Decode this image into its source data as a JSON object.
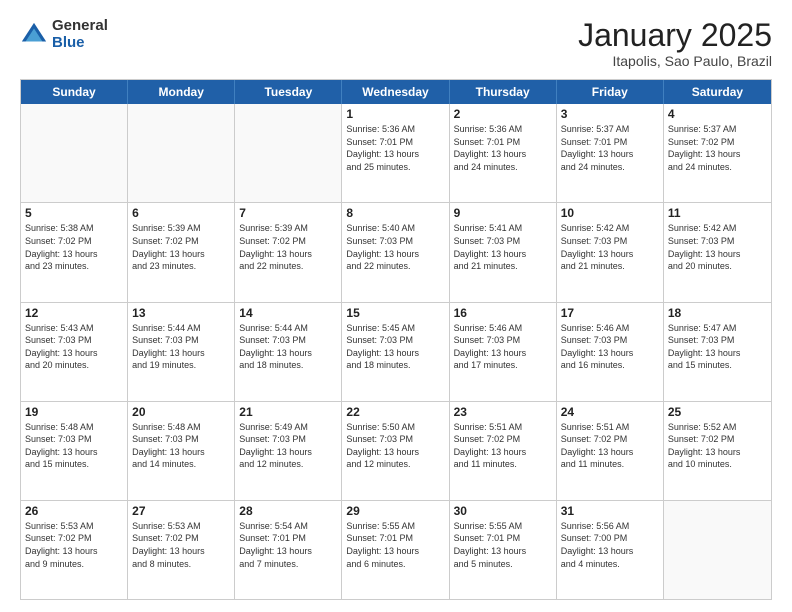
{
  "logo": {
    "general": "General",
    "blue": "Blue"
  },
  "header": {
    "month": "January 2025",
    "location": "Itapolis, Sao Paulo, Brazil"
  },
  "days_of_week": [
    "Sunday",
    "Monday",
    "Tuesday",
    "Wednesday",
    "Thursday",
    "Friday",
    "Saturday"
  ],
  "weeks": [
    [
      {
        "day": "",
        "info": ""
      },
      {
        "day": "",
        "info": ""
      },
      {
        "day": "",
        "info": ""
      },
      {
        "day": "1",
        "info": "Sunrise: 5:36 AM\nSunset: 7:01 PM\nDaylight: 13 hours\nand 25 minutes."
      },
      {
        "day": "2",
        "info": "Sunrise: 5:36 AM\nSunset: 7:01 PM\nDaylight: 13 hours\nand 24 minutes."
      },
      {
        "day": "3",
        "info": "Sunrise: 5:37 AM\nSunset: 7:01 PM\nDaylight: 13 hours\nand 24 minutes."
      },
      {
        "day": "4",
        "info": "Sunrise: 5:37 AM\nSunset: 7:02 PM\nDaylight: 13 hours\nand 24 minutes."
      }
    ],
    [
      {
        "day": "5",
        "info": "Sunrise: 5:38 AM\nSunset: 7:02 PM\nDaylight: 13 hours\nand 23 minutes."
      },
      {
        "day": "6",
        "info": "Sunrise: 5:39 AM\nSunset: 7:02 PM\nDaylight: 13 hours\nand 23 minutes."
      },
      {
        "day": "7",
        "info": "Sunrise: 5:39 AM\nSunset: 7:02 PM\nDaylight: 13 hours\nand 22 minutes."
      },
      {
        "day": "8",
        "info": "Sunrise: 5:40 AM\nSunset: 7:03 PM\nDaylight: 13 hours\nand 22 minutes."
      },
      {
        "day": "9",
        "info": "Sunrise: 5:41 AM\nSunset: 7:03 PM\nDaylight: 13 hours\nand 21 minutes."
      },
      {
        "day": "10",
        "info": "Sunrise: 5:42 AM\nSunset: 7:03 PM\nDaylight: 13 hours\nand 21 minutes."
      },
      {
        "day": "11",
        "info": "Sunrise: 5:42 AM\nSunset: 7:03 PM\nDaylight: 13 hours\nand 20 minutes."
      }
    ],
    [
      {
        "day": "12",
        "info": "Sunrise: 5:43 AM\nSunset: 7:03 PM\nDaylight: 13 hours\nand 20 minutes."
      },
      {
        "day": "13",
        "info": "Sunrise: 5:44 AM\nSunset: 7:03 PM\nDaylight: 13 hours\nand 19 minutes."
      },
      {
        "day": "14",
        "info": "Sunrise: 5:44 AM\nSunset: 7:03 PM\nDaylight: 13 hours\nand 18 minutes."
      },
      {
        "day": "15",
        "info": "Sunrise: 5:45 AM\nSunset: 7:03 PM\nDaylight: 13 hours\nand 18 minutes."
      },
      {
        "day": "16",
        "info": "Sunrise: 5:46 AM\nSunset: 7:03 PM\nDaylight: 13 hours\nand 17 minutes."
      },
      {
        "day": "17",
        "info": "Sunrise: 5:46 AM\nSunset: 7:03 PM\nDaylight: 13 hours\nand 16 minutes."
      },
      {
        "day": "18",
        "info": "Sunrise: 5:47 AM\nSunset: 7:03 PM\nDaylight: 13 hours\nand 15 minutes."
      }
    ],
    [
      {
        "day": "19",
        "info": "Sunrise: 5:48 AM\nSunset: 7:03 PM\nDaylight: 13 hours\nand 15 minutes."
      },
      {
        "day": "20",
        "info": "Sunrise: 5:48 AM\nSunset: 7:03 PM\nDaylight: 13 hours\nand 14 minutes."
      },
      {
        "day": "21",
        "info": "Sunrise: 5:49 AM\nSunset: 7:03 PM\nDaylight: 13 hours\nand 12 minutes."
      },
      {
        "day": "22",
        "info": "Sunrise: 5:50 AM\nSunset: 7:03 PM\nDaylight: 13 hours\nand 12 minutes."
      },
      {
        "day": "23",
        "info": "Sunrise: 5:51 AM\nSunset: 7:02 PM\nDaylight: 13 hours\nand 11 minutes."
      },
      {
        "day": "24",
        "info": "Sunrise: 5:51 AM\nSunset: 7:02 PM\nDaylight: 13 hours\nand 11 minutes."
      },
      {
        "day": "25",
        "info": "Sunrise: 5:52 AM\nSunset: 7:02 PM\nDaylight: 13 hours\nand 10 minutes."
      }
    ],
    [
      {
        "day": "26",
        "info": "Sunrise: 5:53 AM\nSunset: 7:02 PM\nDaylight: 13 hours\nand 9 minutes."
      },
      {
        "day": "27",
        "info": "Sunrise: 5:53 AM\nSunset: 7:02 PM\nDaylight: 13 hours\nand 8 minutes."
      },
      {
        "day": "28",
        "info": "Sunrise: 5:54 AM\nSunset: 7:01 PM\nDaylight: 13 hours\nand 7 minutes."
      },
      {
        "day": "29",
        "info": "Sunrise: 5:55 AM\nSunset: 7:01 PM\nDaylight: 13 hours\nand 6 minutes."
      },
      {
        "day": "30",
        "info": "Sunrise: 5:55 AM\nSunset: 7:01 PM\nDaylight: 13 hours\nand 5 minutes."
      },
      {
        "day": "31",
        "info": "Sunrise: 5:56 AM\nSunset: 7:00 PM\nDaylight: 13 hours\nand 4 minutes."
      },
      {
        "day": "",
        "info": ""
      }
    ]
  ]
}
